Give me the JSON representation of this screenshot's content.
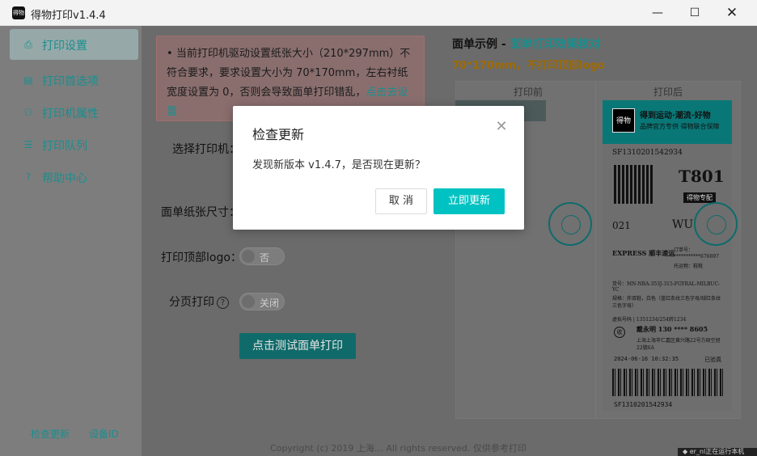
{
  "window": {
    "title": "得物打印v1.4.4",
    "icon_text": "得物",
    "controls": {
      "minimize": "—",
      "maximize": "☐",
      "close": "✕"
    }
  },
  "sidebar": {
    "items": [
      {
        "label": "打印设置",
        "icon": "printer-icon",
        "glyph": "⎙",
        "active": true
      },
      {
        "label": "打印首选项",
        "icon": "document-icon",
        "glyph": "▤",
        "active": false
      },
      {
        "label": "打印机属性",
        "icon": "nodes-icon",
        "glyph": "⚇",
        "active": false
      },
      {
        "label": "打印队列",
        "icon": "list-icon",
        "glyph": "☰",
        "active": false
      },
      {
        "label": "帮助中心",
        "icon": "help-icon",
        "glyph": "?",
        "active": false
      }
    ],
    "footer": {
      "check_update": "检查更新",
      "device_id": "设备ID"
    }
  },
  "main": {
    "warning": {
      "bullet": "•",
      "text": "当前打印机驱动设置纸张大小（210*297mm）不符合要求，要求设置大小为 70*170mm，左右衬纸宽度设置为 0，否则会导致面单打印错乱，",
      "link": "点击去设置"
    },
    "select_printer_label": "选择打印机：",
    "paper_size_label": "面单纸张尺寸：",
    "print_logo_label": "打印顶部logo：",
    "print_logo_value": "否",
    "paging_label": "分页打印",
    "paging_value": "关闭",
    "test_print_button": "点击测试面单打印"
  },
  "preview": {
    "title_prefix": "面单示例 - ",
    "title_highlight": "面单打印效果核对",
    "subtitle": "70*170mm，不打印顶部logo",
    "before_label": "打印前",
    "after_label": "打印后",
    "label": {
      "logo_text": "得物",
      "banner_line1": "得到运动·潮流·好物",
      "banner_line2": "品牌官方专供 得物联合保障",
      "tracking": "SF1310201542934",
      "code": "T801",
      "code_tag": "得物专配",
      "route_left": "021",
      "route_right": "WU",
      "express": "EXPRESS 顺丰速运",
      "order_no_label": "订单号：",
      "order_no": "***********676697",
      "method": "托运物：鞋靴",
      "goods": "货号：MN-NBA-353J-315-FGYRAL-MILBUC-YC",
      "spec": "规格：炸双鞋，白色（蓝红条纹三色字母/绒红条纹三色字母）",
      "sender": "虚拟号码 | 1351234/254转1234",
      "recv_tag": "收",
      "receiver": "戴永明 130 **** 8605",
      "address": "上海上海市仁嘉区黄兴路22号方硕空旭22號6A",
      "datetime": "2024-06-16 10:32:35",
      "checked": "已验真",
      "barcode_text": "SF1310201542934"
    }
  },
  "footer": {
    "copyright": "Copyright (c) 2019 上海… All rights reserved. 仅供参考打印",
    "tray": "◆ er_nl正在运行本机"
  },
  "dialog": {
    "title": "检查更新",
    "message": "发现新版本 v1.4.7，是否现在更新？",
    "cancel": "取 消",
    "confirm": "立即更新",
    "close_glyph": "✕"
  }
}
